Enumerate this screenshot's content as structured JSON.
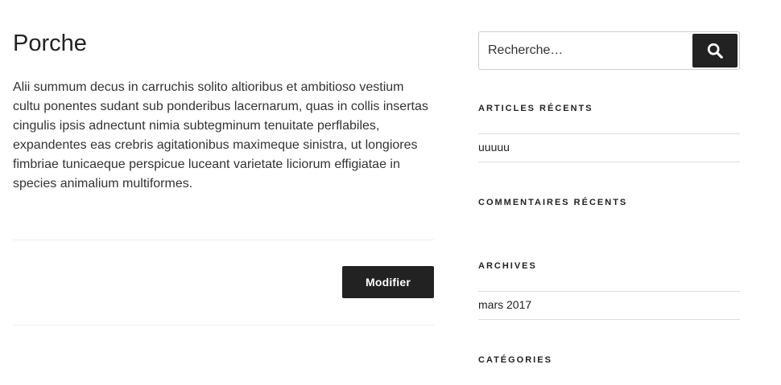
{
  "post": {
    "title": "Porche",
    "content": "Alii summum decus in carruchis solito altioribus et ambitioso vestium cultu ponentes sudant sub ponderibus lacernarum, quas in collis insertas cingulis ipsis adnectunt nimia subtegminum tenuitate perflabiles, expandentes eas crebris agitationibus maximeque sinistra, ut longiores fimbriae tunicaeque perspicue luceant varietate liciorum effigiatae in species animalium multiformes.",
    "edit_label": "Modifier"
  },
  "sidebar": {
    "search": {
      "placeholder": "Recherche…",
      "submit_icon": "search-icon"
    },
    "widgets": {
      "recent_posts": {
        "title": "Articles récents",
        "items": [
          "uuuuu"
        ]
      },
      "recent_comments": {
        "title": "Commentaires récents"
      },
      "archives": {
        "title": "Archives",
        "items": [
          "mars 2017"
        ]
      },
      "categories": {
        "title": "Catégories"
      }
    }
  },
  "colors": {
    "button_bg": "#222222",
    "button_text": "#ffffff",
    "text": "#333333",
    "divider": "#eeeeee"
  }
}
